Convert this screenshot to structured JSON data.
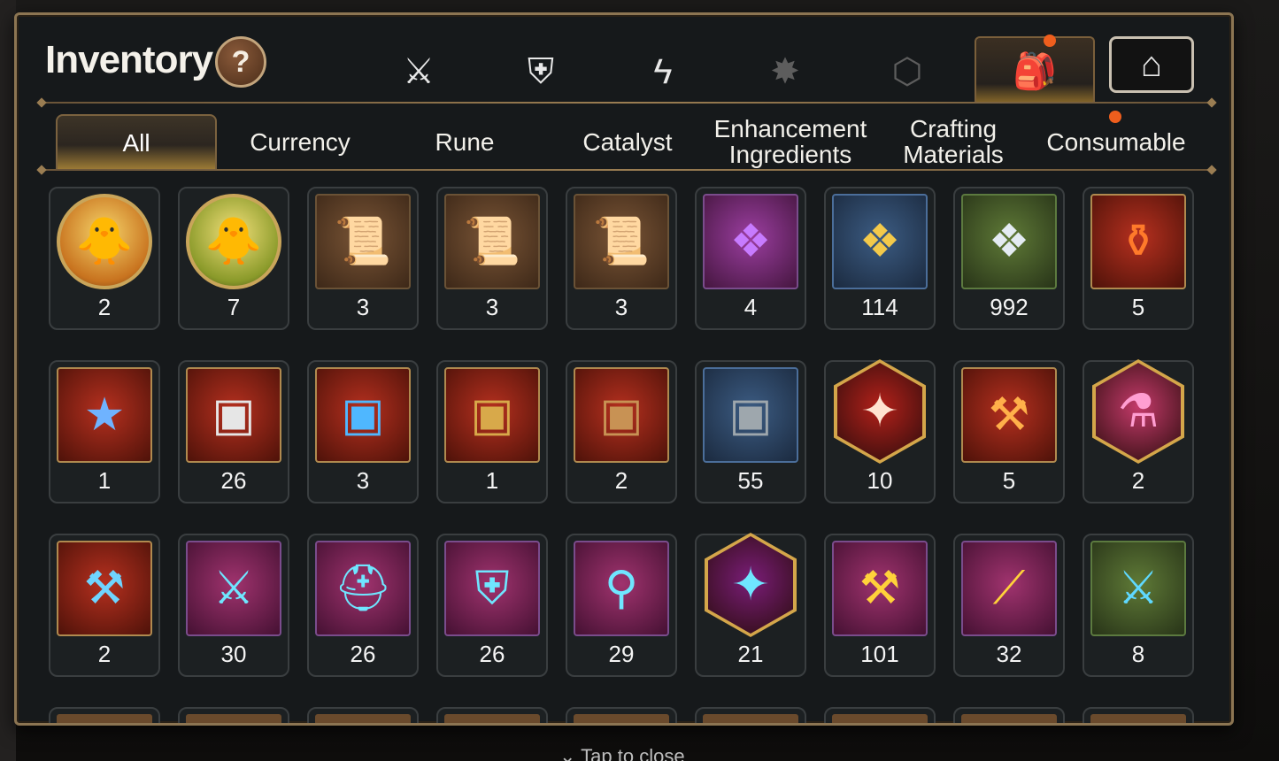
{
  "title": "Inventory",
  "help_label": "?",
  "category_tabs": [
    {
      "icon": "sword-shield-icon",
      "glyph": "⚔",
      "state": "normal"
    },
    {
      "icon": "broken-shield-icon",
      "glyph": "⛨",
      "state": "normal"
    },
    {
      "icon": "lightning-icon",
      "glyph": "ϟ",
      "state": "normal"
    },
    {
      "icon": "burst-icon",
      "glyph": "✸",
      "state": "disabled"
    },
    {
      "icon": "cube-icon",
      "glyph": "⬡",
      "state": "disabled"
    },
    {
      "icon": "bag-icon",
      "glyph": "🎒",
      "state": "active"
    },
    {
      "icon": "storehouse-icon",
      "glyph": "⌂",
      "state": "framed"
    }
  ],
  "subtabs": [
    {
      "label": "All",
      "active": true
    },
    {
      "label": "Currency"
    },
    {
      "label": "Rune"
    },
    {
      "label": "Catalyst"
    },
    {
      "label": "Enhancement\nIngredients"
    },
    {
      "label": "Crafting\nMaterials"
    },
    {
      "label": "Consumable",
      "badge": true
    }
  ],
  "items": [
    {
      "icon": "gold-chick-portrait-icon",
      "count": "2"
    },
    {
      "icon": "green-chick-portrait-icon",
      "count": "7"
    },
    {
      "icon": "scroll-upgrade-icon",
      "count": "3"
    },
    {
      "icon": "rainbow-scroll-upgrade-icon",
      "count": "3"
    },
    {
      "icon": "scroll-upgrade-icon",
      "count": "3"
    },
    {
      "icon": "purple-crystal-icon",
      "count": "4"
    },
    {
      "icon": "gold-crystal-icon",
      "count": "114"
    },
    {
      "icon": "silver-crystal-icon",
      "count": "992"
    },
    {
      "icon": "red-potion-icon",
      "count": "5"
    },
    {
      "icon": "star-potion-icon",
      "count": "1"
    },
    {
      "icon": "silver-chest-icon",
      "count": "26"
    },
    {
      "icon": "blue-chest-icon",
      "count": "3"
    },
    {
      "icon": "dark-gold-chest-icon",
      "count": "1"
    },
    {
      "icon": "wood-gold-chest-icon",
      "count": "2"
    },
    {
      "icon": "iron-chest-icon",
      "count": "55"
    },
    {
      "icon": "red-sword-gem-icon",
      "count": "10"
    },
    {
      "icon": "red-hammer-gem-icon",
      "count": "5"
    },
    {
      "icon": "pink-potion-icon",
      "count": "2"
    },
    {
      "icon": "blue-hammer-rune-icon",
      "count": "2"
    },
    {
      "icon": "sword-rune-icon",
      "count": "30"
    },
    {
      "icon": "helmet-rune-icon",
      "count": "26"
    },
    {
      "icon": "armor-rune-icon",
      "count": "26"
    },
    {
      "icon": "boot-rune-icon",
      "count": "29"
    },
    {
      "icon": "cross-rune-icon",
      "count": "21"
    },
    {
      "icon": "gold-hammer-rune-icon",
      "count": "101"
    },
    {
      "icon": "gold-blade-rune-icon",
      "count": "32"
    },
    {
      "icon": "sword-stone-icon",
      "count": "8"
    }
  ],
  "footer": {
    "tap_close": "Tap to close"
  },
  "colors": {
    "accent_gold": "#c9a55a",
    "notification": "#ef5e1d",
    "frame": "#8c7552"
  }
}
